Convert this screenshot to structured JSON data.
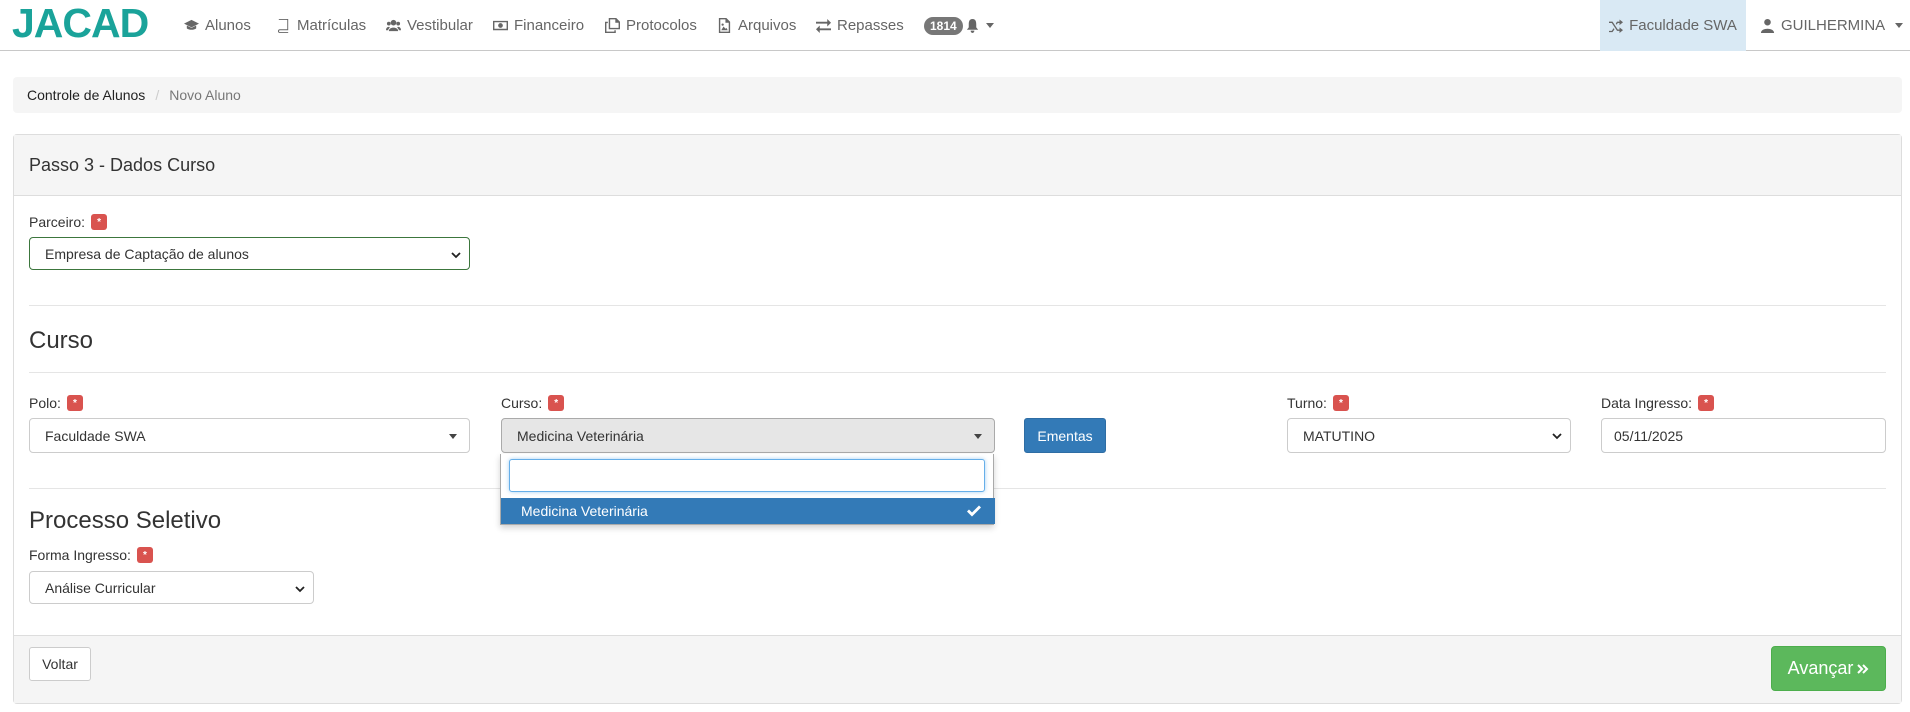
{
  "navbar": {
    "logo_text": "JACAD",
    "items": [
      {
        "label": "Alunos",
        "icon": "graduation-cap-icon"
      },
      {
        "label": "Matrículas",
        "icon": "book-icon"
      },
      {
        "label": "Vestibular",
        "icon": "users-icon"
      },
      {
        "label": "Financeiro",
        "icon": "money-icon"
      },
      {
        "label": "Protocolos",
        "icon": "copy-icon"
      },
      {
        "label": "Arquivos",
        "icon": "file-image-icon"
      },
      {
        "label": "Repasses",
        "icon": "exchange-icon"
      }
    ],
    "notification_count": "1814",
    "faculty_label": "Faculdade SWA",
    "user_label": "GUILHERMINA"
  },
  "breadcrumb": {
    "items": [
      "Controle de Alunos",
      "Novo Aluno"
    ],
    "separator": "/"
  },
  "panel": {
    "title": "Passo 3 - Dados Curso",
    "required_mark": "*",
    "parceiro": {
      "label": "Parceiro:",
      "value": "Empresa de Captação de alunos"
    },
    "section_curso": "Curso",
    "polo": {
      "label": "Polo:",
      "value": "Faculdade SWA"
    },
    "curso": {
      "label": "Curso:",
      "value": "Medicina Veterinária"
    },
    "ementas_button": "Ementas",
    "turno": {
      "label": "Turno:",
      "value": "MATUTINO"
    },
    "data_ingresso": {
      "label": "Data Ingresso:",
      "value": "05/11/2025"
    },
    "section_processo": "Processo Seletivo",
    "forma_ingresso": {
      "label": "Forma Ingresso:",
      "value": "Análise Curricular"
    },
    "back_button": "Voltar",
    "next_button": "Avançar"
  },
  "curso_dropdown": {
    "search_value": "",
    "options": [
      {
        "label": "Medicina Veterinária",
        "selected": true
      }
    ]
  },
  "colors": {
    "brand": "#1aa39a",
    "primary": "#337ab7",
    "success": "#5cb85c",
    "danger": "#d9534f"
  }
}
